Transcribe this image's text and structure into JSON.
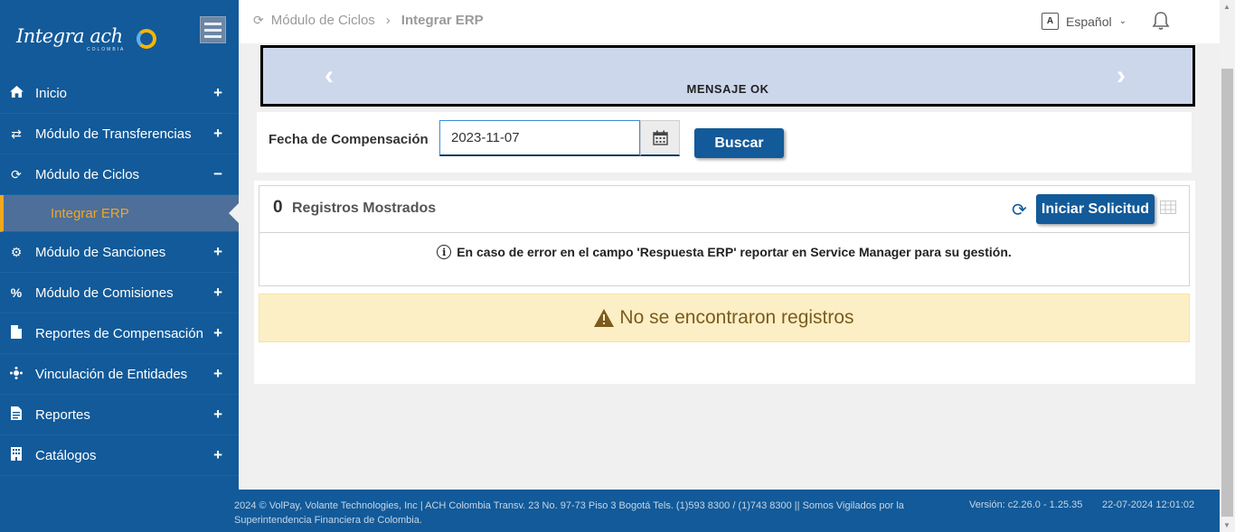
{
  "brand": {
    "name": "Integra ach",
    "sub": "COLOMBIA"
  },
  "sidebar": {
    "items": [
      {
        "label": "Inicio",
        "icon": "home-icon",
        "toggle": "+"
      },
      {
        "label": "Módulo de Transferencias",
        "icon": "exchange-icon",
        "toggle": "+"
      },
      {
        "label": "Módulo de Ciclos",
        "icon": "refresh-icon",
        "toggle": "−"
      },
      {
        "label": "Integrar ERP"
      },
      {
        "label": "Módulo de Sanciones",
        "icon": "gear-icon",
        "toggle": "+"
      },
      {
        "label": "Módulo de Comisiones",
        "icon": "percent-icon",
        "toggle": "+"
      },
      {
        "label": "Reportes de Compensación",
        "icon": "file-icon",
        "toggle": "+"
      },
      {
        "label": "Vinculación de Entidades",
        "icon": "sitemap-icon",
        "toggle": "+"
      },
      {
        "label": "Reportes",
        "icon": "report-icon",
        "toggle": "+"
      },
      {
        "label": "Catálogos",
        "icon": "building-icon",
        "toggle": "+"
      }
    ]
  },
  "header": {
    "breadcrumb": {
      "parent": "Módulo de Ciclos",
      "current": "Integrar ERP"
    },
    "language": "Español"
  },
  "banner": {
    "message": "MENSAJE OK"
  },
  "search": {
    "label": "Fecha de Compensación",
    "date_value": "2023-11-07",
    "button": "Buscar"
  },
  "results": {
    "count": "0",
    "count_label": "Registros Mostrados",
    "request_button": "Iniciar Solicitud",
    "info": "En caso de error en el campo 'Respuesta ERP' reportar en Service Manager para su gestión.",
    "empty": "No se encontraron registros"
  },
  "footer": {
    "copyright": "2024 © VolPay, Volante Technologies, Inc | ACH Colombia Transv. 23 No. 97-73 Piso 3 Bogotá Tels. (1)593 8300 / (1)743 8300 || Somos Vigilados por la Superintendencia Financiera de Colombia.",
    "version": "Versión: c2.26.0 - 1.25.35",
    "timestamp": "22-07-2024 12:01:02"
  },
  "colors": {
    "primary": "#125a99",
    "accent": "#f3a623",
    "banner": "#ccd7ec",
    "warning_bg": "#fcefc5"
  }
}
